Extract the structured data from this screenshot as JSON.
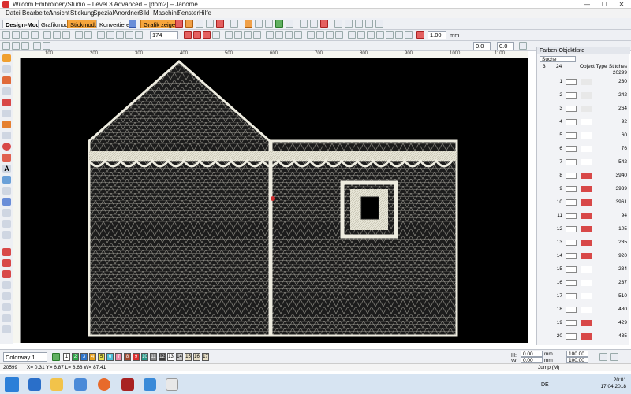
{
  "window": {
    "title": "Wilcom EmbroideryStudio – Level 3 Advanced – [dom2] – Janome",
    "min": "—",
    "max": "☐",
    "close": "✕"
  },
  "menu": [
    "Datei",
    "Bearbeiten",
    "Ansicht",
    "Stickung",
    "Spezial",
    "Anordnen",
    "Bild",
    "Maschine",
    "Fenster",
    "Hilfe"
  ],
  "toolbar2": {
    "design_mode": "Design-Modus",
    "graphic_mode": "Grafikmodus",
    "stitch_mode": "Stickmodus",
    "convert": "Konvertieren",
    "show_graphic": "Grafik zeigen"
  },
  "toolbar3": {
    "zoom_value": "174",
    "scale_value": "1.00",
    "unit": "mm",
    "field_a": "0.0",
    "field_b": "0.0"
  },
  "ruler": {
    "h": [
      "100",
      "200",
      "300",
      "400",
      "500",
      "600",
      "700",
      "800",
      "900",
      "1000",
      "1100"
    ]
  },
  "panel": {
    "title": "Farben-Objektliste",
    "search": "Suche",
    "hdr_num": "3",
    "hdr_count": "24",
    "hdr_cols": "Object Type",
    "hdr_stitch": "Stitches",
    "hdr_total": "20299",
    "rows": [
      {
        "n": "1",
        "s": "230"
      },
      {
        "n": "2",
        "s": "242"
      },
      {
        "n": "3",
        "s": "264"
      },
      {
        "n": "4",
        "s": "92"
      },
      {
        "n": "5",
        "s": "60"
      },
      {
        "n": "6",
        "s": "76"
      },
      {
        "n": "7",
        "s": "542"
      },
      {
        "n": "8",
        "s": "3940"
      },
      {
        "n": "9",
        "s": "3939"
      },
      {
        "n": "10",
        "s": "3961"
      },
      {
        "n": "11",
        "s": "94"
      },
      {
        "n": "12",
        "s": "105"
      },
      {
        "n": "13",
        "s": "235"
      },
      {
        "n": "14",
        "s": "920"
      },
      {
        "n": "15",
        "s": "234"
      },
      {
        "n": "16",
        "s": "237"
      },
      {
        "n": "17",
        "s": "510"
      },
      {
        "n": "18",
        "s": "480"
      },
      {
        "n": "19",
        "s": "429"
      },
      {
        "n": "20",
        "s": "435"
      }
    ]
  },
  "bottom": {
    "colorway": "Colorway 1",
    "swatches": [
      "1",
      "2",
      "3",
      "4",
      "5",
      "6",
      "7",
      "8",
      "9",
      "10",
      "11",
      "12",
      "13",
      "14",
      "15",
      "16",
      "17"
    ],
    "h_label": "H:",
    "w_label": "W:",
    "h_value": "0.00",
    "w_value": "0.00",
    "mm": "mm",
    "pct1": "100.00",
    "pct2": "100.00"
  },
  "status": {
    "left": "20599",
    "coords": "X=  0.31 Y=  6.87 L=  8.68 W= 87.41",
    "right": "Jump (M)"
  },
  "taskbar": {
    "lang": "DE",
    "time": "20:01",
    "date": "17.04.2018"
  },
  "colors": {
    "accent": "#f6a53c",
    "canvas": "#000000",
    "stitch": "#e8e6d8"
  }
}
